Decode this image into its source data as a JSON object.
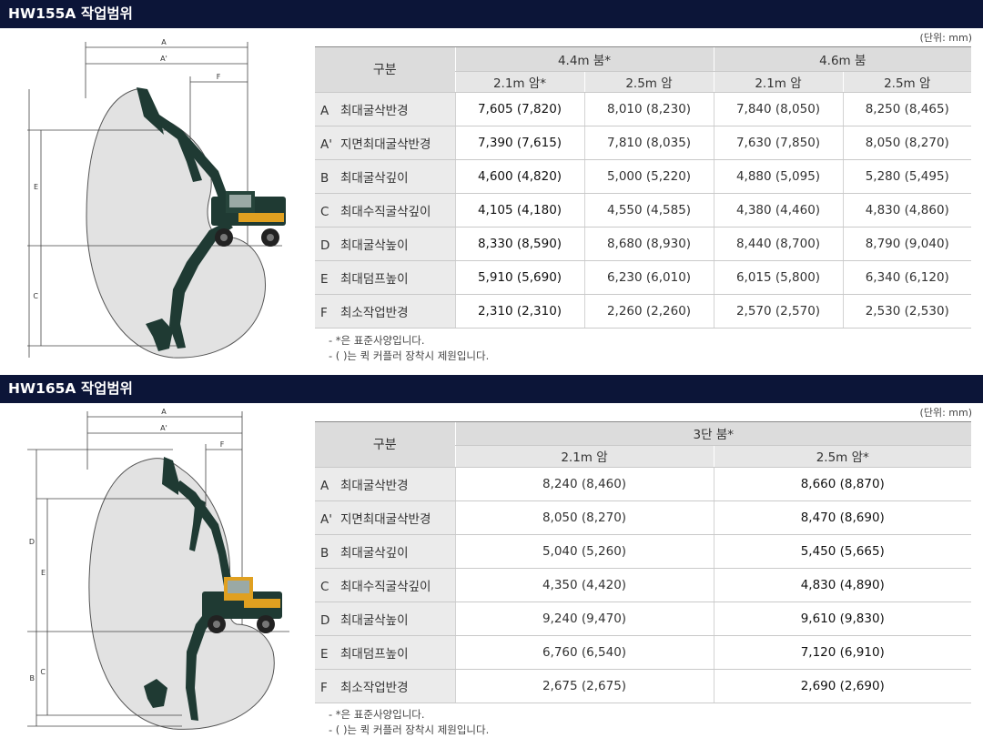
{
  "sections": [
    {
      "title": "HW155A 작업범위",
      "unit": "(단위: mm)",
      "header": {
        "gubun": "구분",
        "groups": [
          "4.4m 붐*",
          "4.6m 붐"
        ],
        "subs": [
          "2.1m 암*",
          "2.5m 암",
          "2.1m 암",
          "2.5m 암"
        ]
      },
      "rows": [
        {
          "letter": "A",
          "label": "최대굴삭반경",
          "values": [
            "7,605 (7,820)",
            "8,010 (8,230)",
            "7,840 (8,050)",
            "8,250 (8,465)"
          ]
        },
        {
          "letter": "A'",
          "label": "지면최대굴삭반경",
          "values": [
            "7,390 (7,615)",
            "7,810 (8,035)",
            "7,630 (7,850)",
            "8,050 (8,270)"
          ]
        },
        {
          "letter": "B",
          "label": "최대굴삭깊이",
          "values": [
            "4,600 (4,820)",
            "5,000 (5,220)",
            "4,880 (5,095)",
            "5,280 (5,495)"
          ]
        },
        {
          "letter": "C",
          "label": "최대수직굴삭깊이",
          "values": [
            "4,105 (4,180)",
            "4,550 (4,585)",
            "4,380 (4,460)",
            "4,830 (4,860)"
          ]
        },
        {
          "letter": "D",
          "label": "최대굴삭높이",
          "values": [
            "8,330 (8,590)",
            "8,680 (8,930)",
            "8,440 (8,700)",
            "8,790 (9,040)"
          ]
        },
        {
          "letter": "E",
          "label": "최대덤프높이",
          "values": [
            "5,910 (5,690)",
            "6,230 (6,010)",
            "6,015 (5,800)",
            "6,340 (6,120)"
          ]
        },
        {
          "letter": "F",
          "label": "최소작업반경",
          "values": [
            "2,310 (2,310)",
            "2,260 (2,260)",
            "2,570 (2,570)",
            "2,530 (2,530)"
          ]
        }
      ],
      "notes": [
        "- *은 표준사양입니다.",
        "- ( )는 퀵 커플러 장착시 제원입니다."
      ],
      "diagram_labels": {
        "A": "A",
        "A2": "A'",
        "F": "F",
        "E": "E",
        "C": "C"
      }
    },
    {
      "title": "HW165A 작업범위",
      "unit": "(단위: mm)",
      "header": {
        "gubun": "구분",
        "groups": [
          "3단 붐*"
        ],
        "subs": [
          "2.1m 암",
          "2.5m 암*"
        ]
      },
      "rows": [
        {
          "letter": "A",
          "label": "최대굴삭반경",
          "values": [
            "8,240 (8,460)",
            "8,660 (8,870)"
          ]
        },
        {
          "letter": "A'",
          "label": "지면최대굴삭반경",
          "values": [
            "8,050 (8,270)",
            "8,470 (8,690)"
          ]
        },
        {
          "letter": "B",
          "label": "최대굴삭깊이",
          "values": [
            "5,040 (5,260)",
            "5,450 (5,665)"
          ]
        },
        {
          "letter": "C",
          "label": "최대수직굴삭깊이",
          "values": [
            "4,350 (4,420)",
            "4,830 (4,890)"
          ]
        },
        {
          "letter": "D",
          "label": "최대굴삭높이",
          "values": [
            "9,240 (9,470)",
            "9,610 (9,830)"
          ]
        },
        {
          "letter": "E",
          "label": "최대덤프높이",
          "values": [
            "6,760 (6,540)",
            "7,120 (6,910)"
          ]
        },
        {
          "letter": "F",
          "label": "최소작업반경",
          "values": [
            "2,675 (2,675)",
            "2,690 (2,690)"
          ]
        }
      ],
      "notes": [
        "- *은 표준사양입니다.",
        "- ( )는 퀵 커플러 장착시 제원입니다."
      ],
      "diagram_labels": {
        "A": "A",
        "A2": "A'",
        "F": "F",
        "D": "D",
        "E": "E",
        "C": "C",
        "B": "B"
      }
    }
  ],
  "colors": {
    "header_bg": "#0c1538",
    "machine": "#1f3a33",
    "accent": "#e0a020",
    "envelope": "#e2e2e2"
  }
}
